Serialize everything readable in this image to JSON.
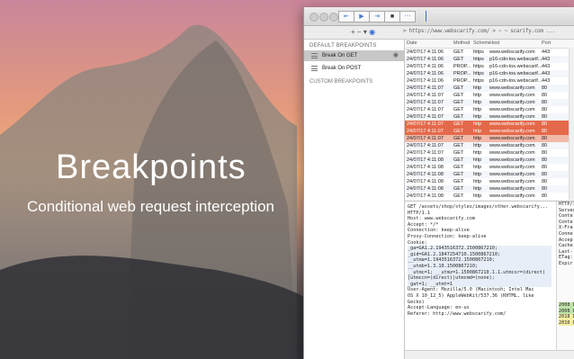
{
  "hero": {
    "title": "Breakpoints",
    "subtitle": "Conditional web request interception"
  },
  "window": {
    "url": "> https://www.webscarify.com/ >  ~  ~ scarify.com ..."
  },
  "sidebar": {
    "section_label": "DEFAULT BREAKPOINTS",
    "items": [
      {
        "label": "Break On GET",
        "selected": true
      },
      {
        "label": "Break On POST",
        "selected": false
      }
    ],
    "section2_label": "CUSTOM BREAKPOINTS"
  },
  "table": {
    "columns": [
      "Date",
      "Method",
      "Scheme",
      "Host",
      "Port"
    ],
    "rows": [
      {
        "date": "24/07/17 4:11:06",
        "method": "GET",
        "scheme": "https",
        "host": "www.webscarify.com",
        "port": "443"
      },
      {
        "date": "24/07/17 4:11:06",
        "method": "GET",
        "scheme": "https",
        "host": "p16-cdn-tos.webscarif...",
        "port": "443"
      },
      {
        "date": "24/07/17 4:11:06",
        "method": "PROP...",
        "scheme": "https",
        "host": "p16-cdn-tos.webscarif...",
        "port": "443"
      },
      {
        "date": "24/07/17 4:11:06",
        "method": "PROP...",
        "scheme": "https",
        "host": "p16-cdn-tos.webscarif...",
        "port": "443"
      },
      {
        "date": "24/07/17 4:11:06",
        "method": "PROP...",
        "scheme": "https",
        "host": "p16-cdn-tos.webscarif...",
        "port": "443"
      },
      {
        "date": "24/07/17 4:11:07",
        "method": "GET",
        "scheme": "http",
        "host": "www.webscarify.com",
        "port": "80"
      },
      {
        "date": "24/07/17 4:11:07",
        "method": "GET",
        "scheme": "http",
        "host": "www.webscarify.com",
        "port": "80"
      },
      {
        "date": "24/07/17 4:11:07",
        "method": "GET",
        "scheme": "http",
        "host": "www.webscarify.com",
        "port": "80"
      },
      {
        "date": "24/07/17 4:11:07",
        "method": "GET",
        "scheme": "http",
        "host": "www.webscarify.com",
        "port": "80"
      },
      {
        "date": "24/07/17 4:11:07",
        "method": "GET",
        "scheme": "http",
        "host": "www.webscarify.com",
        "port": "80"
      },
      {
        "date": "24/07/17 4:11:07",
        "method": "GET",
        "scheme": "http",
        "host": "www.webscarify.com",
        "port": "80",
        "state": "hl"
      },
      {
        "date": "24/07/17 4:11:07",
        "method": "GET",
        "scheme": "http",
        "host": "www.webscarify.com",
        "port": "80",
        "state": "hl"
      },
      {
        "date": "24/07/17 4:11:07",
        "method": "GET",
        "scheme": "http",
        "host": "www.webscarify.com",
        "port": "80",
        "state": "sel"
      },
      {
        "date": "24/07/17 4:11:07",
        "method": "GET",
        "scheme": "http",
        "host": "www.webscarify.com",
        "port": "80"
      },
      {
        "date": "24/07/17 4:11:07",
        "method": "GET",
        "scheme": "http",
        "host": "www.webscarify.com",
        "port": "80"
      },
      {
        "date": "24/07/17 4:11:08",
        "method": "GET",
        "scheme": "http",
        "host": "www.webscarify.com",
        "port": "80"
      },
      {
        "date": "24/07/17 4:11:08",
        "method": "GET",
        "scheme": "http",
        "host": "www.webscarify.com",
        "port": "80"
      },
      {
        "date": "24/07/17 4:11:08",
        "method": "GET",
        "scheme": "http",
        "host": "www.webscarify.com",
        "port": "80"
      },
      {
        "date": "24/07/17 4:11:08",
        "method": "GET",
        "scheme": "http",
        "host": "www.webscarify.com",
        "port": "80"
      },
      {
        "date": "24/07/17 4:11:08",
        "method": "GET",
        "scheme": "http",
        "host": "www.webscarify.com",
        "port": "80"
      },
      {
        "date": "24/07/17 4:11:08",
        "method": "GET",
        "scheme": "http",
        "host": "www.webscarify.com",
        "port": "80"
      }
    ]
  },
  "detail": {
    "request_lines": [
      "GET /assets/shop/styles/images/other.webscarify...",
      "HTTP/1.1",
      "Host: www.webscarify.com",
      "Accept: */*",
      "Connection: keep-alive",
      "Proxy-Connection: keep-alive",
      "Cookie:",
      "_ga=GA1.2.1943516372.1500867210;",
      "_gid=GA1.2.1847254710.1500867210;",
      "__utma=1.1943516372.1500867210;",
      "__utmb=1.3.10.1500867210;",
      "__utmc=1; __utmz=1.1500867210.1.1.utmcsr=(direct)",
      "|utmccn=(direct)|utmcmd=(none);",
      "_gat=1; __utmt=1",
      "User-Agent: Mozilla/5.0 (Macintosh; Intel Mac",
      "OS X 10_12_5) AppleWebKit/537.36 (KHTML, like",
      "Gecko)",
      "Accept-Language: en-us",
      "Referer: http://www.webscarify.com/"
    ],
    "response_lines": [
      "HTTP/1.1",
      "Server:",
      "Conte",
      "Conte",
      "X-Fra",
      "Conne",
      "Accep",
      "Cache",
      "Last-",
      "ETag:",
      "Expir",
      "",
      "",
      "",
      "",
      "",
      "",
      "2008 D",
      "2008 D",
      "2018 D",
      "2010 D"
    ]
  },
  "colors": {
    "highlight_row": "#e4694a",
    "selected_row": "#f2b9a8",
    "accent": "#2f6bd2"
  }
}
